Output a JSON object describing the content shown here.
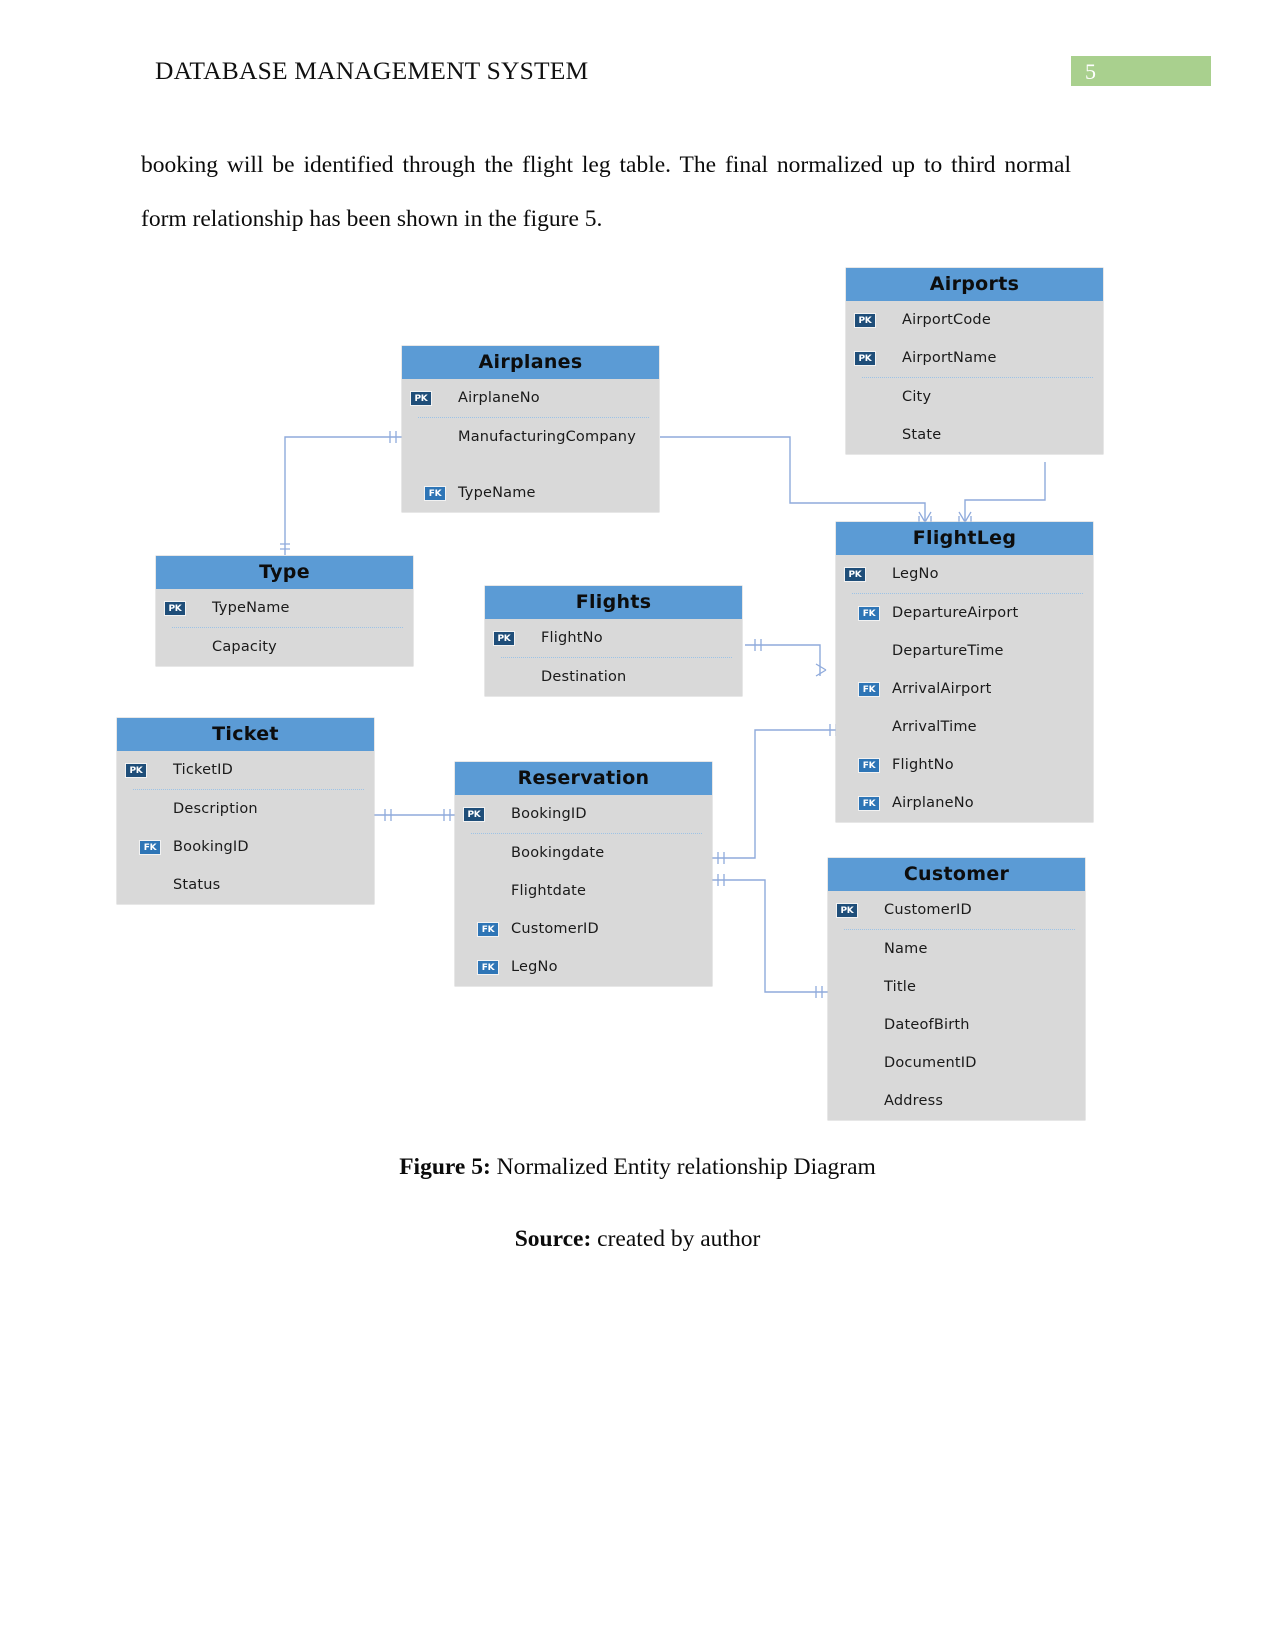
{
  "header": {
    "title": "DATABASE MANAGEMENT SYSTEM",
    "page_number": "5",
    "page_number_bg": "#a9d08e"
  },
  "body": {
    "paragraph": "booking will be identified through the flight leg table. The final normalized up to third normal form relationship has been shown in the figure 5."
  },
  "figure": {
    "caption_lead": "Figure 5:",
    "caption_text": " Normalized Entity relationship Diagram",
    "source_lead": "Source:",
    "source_text": " created by author"
  },
  "diagram": {
    "colors": {
      "title_bar": "#5b9bd5",
      "body": "#d9d9d9",
      "pk_badge": "#1f4e79",
      "fk_badge": "#2e75b6",
      "connector": "#8faadc"
    },
    "entities": [
      {
        "id": "airports",
        "name": "Airports",
        "attributes": [
          {
            "key": "PK",
            "name": "AirportCode"
          },
          {
            "key": "PK",
            "name": "AirportName"
          },
          {
            "key": "",
            "name": "City"
          },
          {
            "key": "",
            "name": "State"
          }
        ]
      },
      {
        "id": "airplanes",
        "name": "Airplanes",
        "attributes": [
          {
            "key": "PK",
            "name": "AirplaneNo"
          },
          {
            "key": "",
            "name": "ManufacturingCompany"
          },
          {
            "key": "FK",
            "name": "TypeName"
          }
        ]
      },
      {
        "id": "flightleg",
        "name": "FlightLeg",
        "attributes": [
          {
            "key": "PK",
            "name": "LegNo"
          },
          {
            "key": "FK",
            "name": "DepartureAirport"
          },
          {
            "key": "",
            "name": "DepartureTime"
          },
          {
            "key": "FK",
            "name": "ArrivalAirport"
          },
          {
            "key": "",
            "name": "ArrivalTime"
          },
          {
            "key": "FK",
            "name": "FlightNo"
          },
          {
            "key": "FK",
            "name": "AirplaneNo"
          }
        ]
      },
      {
        "id": "type",
        "name": "Type",
        "attributes": [
          {
            "key": "PK",
            "name": "TypeName"
          },
          {
            "key": "",
            "name": "Capacity"
          }
        ]
      },
      {
        "id": "flights",
        "name": "Flights",
        "attributes": [
          {
            "key": "PK",
            "name": "FlightNo"
          },
          {
            "key": "",
            "name": "Destination"
          }
        ]
      },
      {
        "id": "ticket",
        "name": "Ticket",
        "attributes": [
          {
            "key": "PK",
            "name": "TicketID"
          },
          {
            "key": "",
            "name": "Description"
          },
          {
            "key": "FK",
            "name": "BookingID"
          },
          {
            "key": "",
            "name": "Status"
          }
        ]
      },
      {
        "id": "reservation",
        "name": "Reservation",
        "attributes": [
          {
            "key": "PK",
            "name": "BookingID"
          },
          {
            "key": "",
            "name": "Bookingdate"
          },
          {
            "key": "",
            "name": "Flightdate"
          },
          {
            "key": "FK",
            "name": "CustomerID"
          },
          {
            "key": "FK",
            "name": "LegNo"
          }
        ]
      },
      {
        "id": "customer",
        "name": "Customer",
        "attributes": [
          {
            "key": "PK",
            "name": "CustomerID"
          },
          {
            "key": "",
            "name": "Name"
          },
          {
            "key": "",
            "name": "Title"
          },
          {
            "key": "",
            "name": "DateofBirth"
          },
          {
            "key": "",
            "name": "DocumentID"
          },
          {
            "key": "",
            "name": "Address"
          }
        ]
      }
    ],
    "relationships": [
      {
        "from": "Type",
        "to": "Airplanes",
        "label": "TypeName"
      },
      {
        "from": "Airplanes",
        "to": "FlightLeg",
        "label": "AirplaneNo"
      },
      {
        "from": "Airports",
        "to": "FlightLeg",
        "label": "AirportCode"
      },
      {
        "from": "Flights",
        "to": "FlightLeg",
        "label": "FlightNo"
      },
      {
        "from": "FlightLeg",
        "to": "Reservation",
        "label": "LegNo"
      },
      {
        "from": "Reservation",
        "to": "Ticket",
        "label": "BookingID"
      },
      {
        "from": "Customer",
        "to": "Reservation",
        "label": "CustomerID"
      }
    ]
  }
}
